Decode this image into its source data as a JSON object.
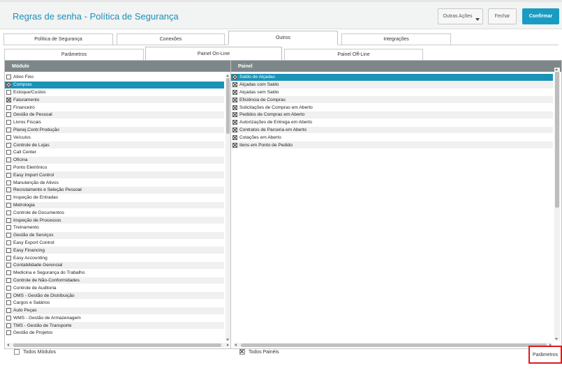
{
  "window": {
    "title": "Regras de senha - Política de Segurança"
  },
  "toolbar": {
    "other_actions": "Outras Ações",
    "close": "Fechar",
    "confirm": "Confirmar"
  },
  "tabs": [
    "Política de Segurança",
    "Conexões",
    "Outros",
    "Integrações"
  ],
  "subtabs": [
    "Parâmetros",
    "Painel On-Line",
    "Painel Off-Line"
  ],
  "modules": {
    "header": "Módulo",
    "items": [
      {
        "label": "Ativo Fixo",
        "checked": false,
        "selected": false
      },
      {
        "label": "Compras",
        "checked": true,
        "selected": true
      },
      {
        "label": "Estoque/Custos",
        "checked": false,
        "selected": false
      },
      {
        "label": "Faturamento",
        "checked": true,
        "selected": false
      },
      {
        "label": "Financeiro",
        "checked": false,
        "selected": false
      },
      {
        "label": "Gestão de Pessoal",
        "checked": false,
        "selected": false
      },
      {
        "label": "Livros Fiscais",
        "checked": false,
        "selected": false
      },
      {
        "label": "Planej.Contr.Produção",
        "checked": false,
        "selected": false
      },
      {
        "label": "Veículos",
        "checked": false,
        "selected": false
      },
      {
        "label": "Controle de Lojas",
        "checked": false,
        "selected": false
      },
      {
        "label": "Call Center",
        "checked": false,
        "selected": false
      },
      {
        "label": "Oficina",
        "checked": false,
        "selected": false
      },
      {
        "label": "Ponto Eletrônico",
        "checked": false,
        "selected": false
      },
      {
        "label": "Easy Import Control",
        "checked": false,
        "selected": false
      },
      {
        "label": "Manutenção de Ativos",
        "checked": false,
        "selected": false
      },
      {
        "label": "Recrutamento e Seleção Pessoal",
        "checked": false,
        "selected": false
      },
      {
        "label": "Inspeção de Entradas",
        "checked": false,
        "selected": false
      },
      {
        "label": "Metrologia",
        "checked": false,
        "selected": false
      },
      {
        "label": "Controle de Documentos",
        "checked": false,
        "selected": false
      },
      {
        "label": "Inspeção de Processos",
        "checked": false,
        "selected": false
      },
      {
        "label": "Treinamento",
        "checked": false,
        "selected": false
      },
      {
        "label": "Gestão de Serviços",
        "checked": false,
        "selected": false
      },
      {
        "label": "Easy Export Control",
        "checked": false,
        "selected": false
      },
      {
        "label": "Easy Financing",
        "checked": false,
        "selected": false
      },
      {
        "label": "Easy Accounting",
        "checked": false,
        "selected": false
      },
      {
        "label": "Contabilidade Gerencial",
        "checked": false,
        "selected": false
      },
      {
        "label": "Medicina e Segurança do Trabalho",
        "checked": false,
        "selected": false
      },
      {
        "label": "Controle de Não-Conformidades",
        "checked": false,
        "selected": false
      },
      {
        "label": "Controle de Auditoria",
        "checked": false,
        "selected": false
      },
      {
        "label": "OMS - Gestão de Distribuição",
        "checked": false,
        "selected": false
      },
      {
        "label": "Cargos e Salários",
        "checked": false,
        "selected": false
      },
      {
        "label": "Auto Peças",
        "checked": false,
        "selected": false
      },
      {
        "label": "WMS - Gestão de Armazenagem",
        "checked": false,
        "selected": false
      },
      {
        "label": "TMS - Gestão de Transporte",
        "checked": false,
        "selected": false
      },
      {
        "label": "Gestão de Projetos",
        "checked": false,
        "selected": false
      }
    ]
  },
  "panels": {
    "header": "Painel",
    "items": [
      {
        "label": "Saldo de Alçadas",
        "checked": true,
        "selected": true
      },
      {
        "label": "Alçadas com Saldo",
        "checked": true,
        "selected": false
      },
      {
        "label": "Alçadas sem Saldo",
        "checked": true,
        "selected": false
      },
      {
        "label": "Eficiência de Compras",
        "checked": true,
        "selected": false
      },
      {
        "label": "Solicitações de Compras em Aberto",
        "checked": true,
        "selected": false
      },
      {
        "label": "Pedidos de Compras em Aberto",
        "checked": true,
        "selected": false
      },
      {
        "label": "Autorizações de Entrega em Aberto",
        "checked": true,
        "selected": false
      },
      {
        "label": "Contratos de Parceria em Aberto",
        "checked": true,
        "selected": false
      },
      {
        "label": "Cotações em Aberto",
        "checked": true,
        "selected": false
      },
      {
        "label": "Itens em Ponto de Pedido",
        "checked": true,
        "selected": false
      }
    ]
  },
  "footer": {
    "all_modules": {
      "label": "Todos Módulos",
      "checked": false
    },
    "all_panels": {
      "label": "Todos Painéis",
      "checked": true
    },
    "params_button": "Parâmetros"
  }
}
